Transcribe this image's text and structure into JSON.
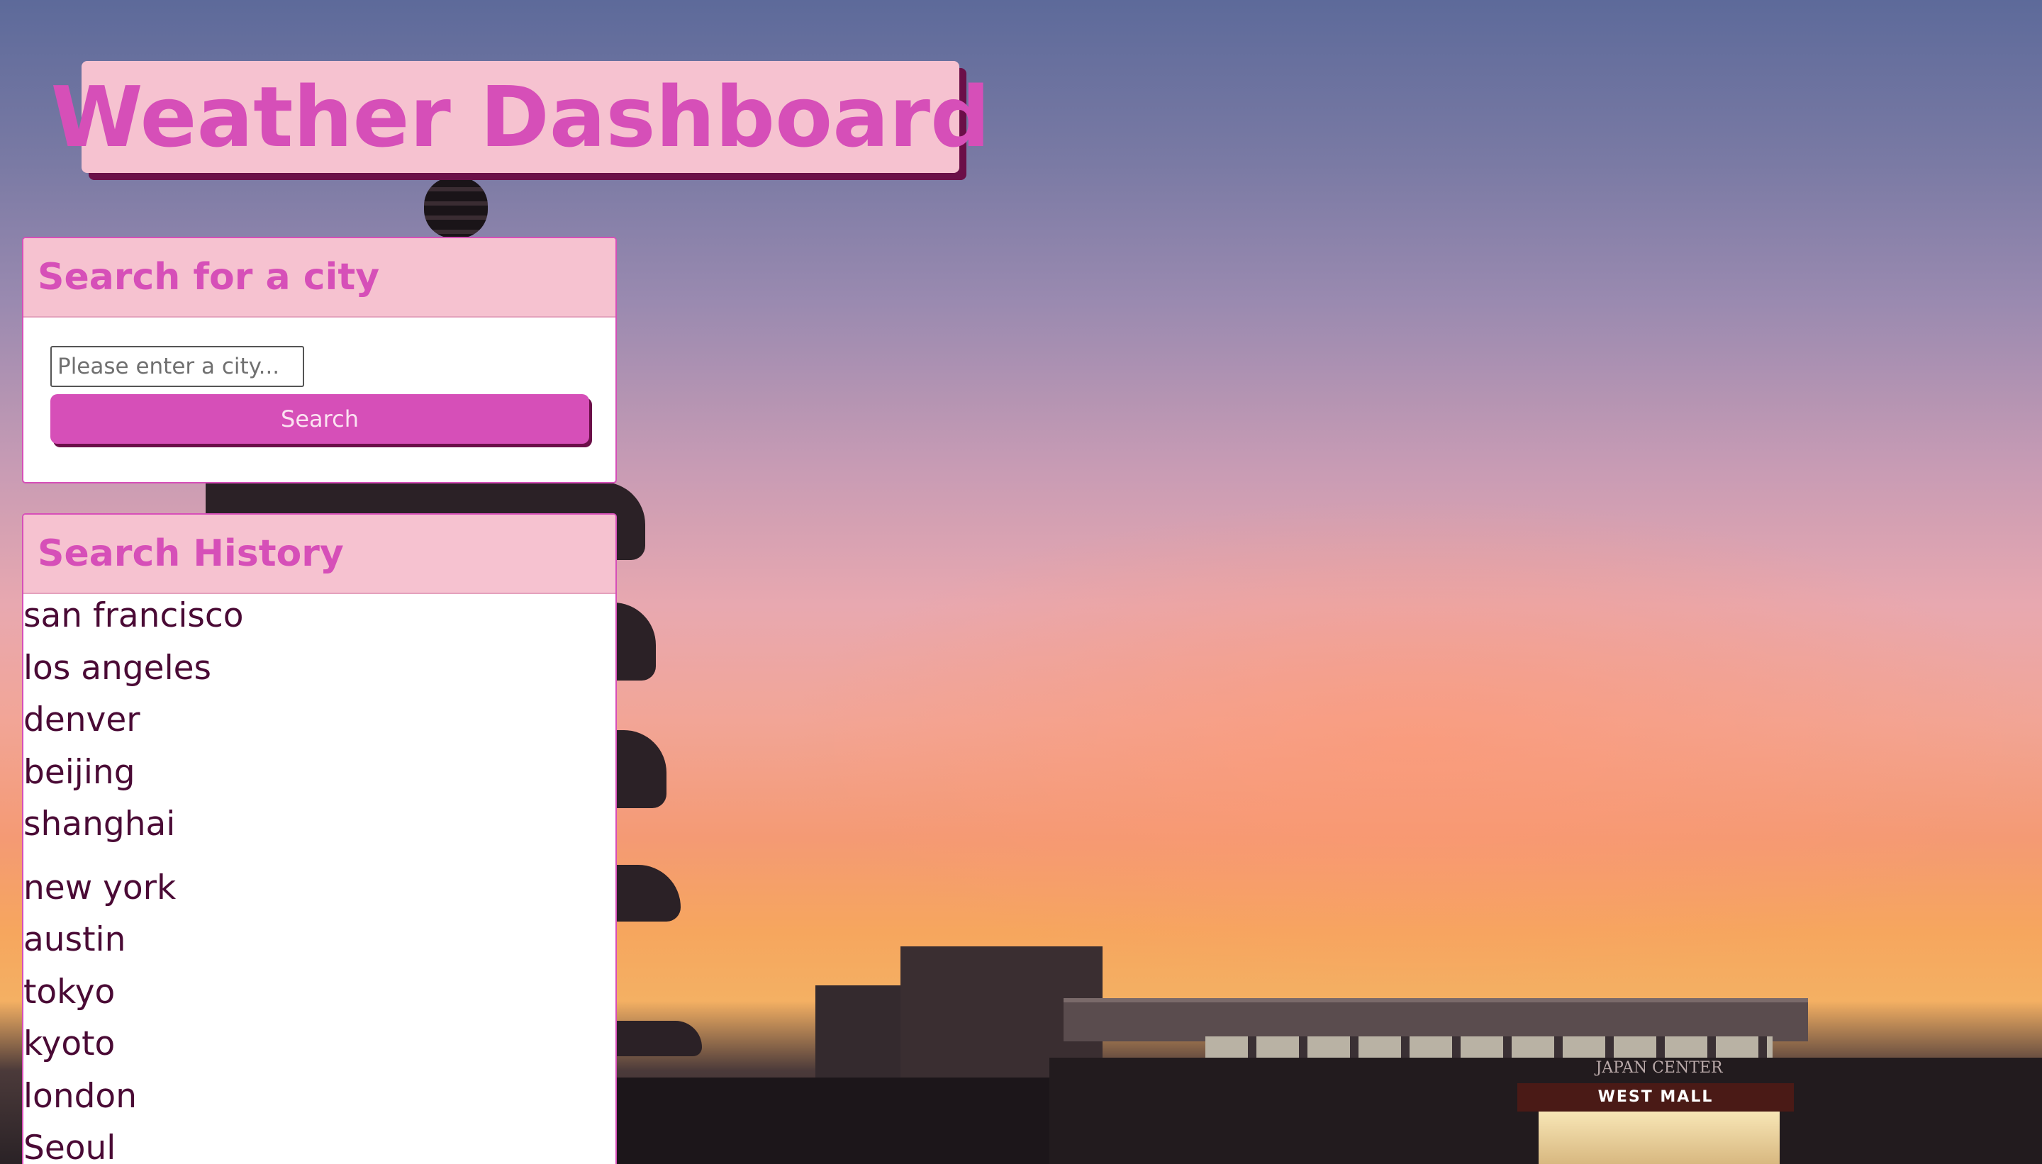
{
  "app": {
    "title": "Weather Dashboard"
  },
  "search_panel": {
    "heading": "Search for a city",
    "input_placeholder": "Please enter a city...",
    "input_value": "",
    "button_label": "Search"
  },
  "history_panel": {
    "heading": "Search History",
    "items": [
      "san francisco",
      "los angeles",
      "denver",
      "beijing",
      "shanghai",
      "new york",
      "austin",
      "tokyo",
      "kyoto",
      "london",
      "Seoul"
    ]
  },
  "background": {
    "mall_label": "JAPAN CENTER",
    "mall_sign": "WEST MALL"
  },
  "colors": {
    "accent": "#d64fb8",
    "header_bg": "#f6c2d0",
    "shadow": "#6b0f48",
    "history_text": "#4a0a35"
  }
}
